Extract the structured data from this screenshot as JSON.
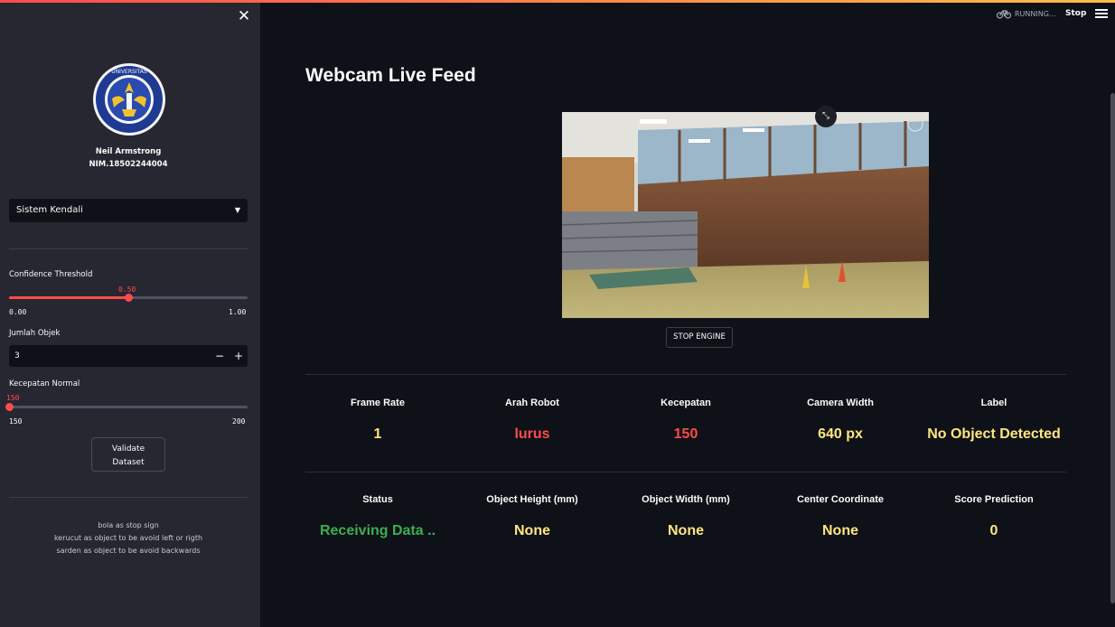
{
  "header": {
    "status_text": "RUNNING...",
    "stop_label": "Stop"
  },
  "sidebar": {
    "profile_name": "Neil Armstrong",
    "profile_nim": "NIM.18502244004",
    "mode_select": {
      "selected": "Sistem Kendali"
    },
    "confidence": {
      "label": "Confidence Threshold",
      "value": "0.50",
      "min": "0.00",
      "max": "1.00",
      "fraction": 0.5
    },
    "jumlah_objek": {
      "label": "Jumlah Objek",
      "value": "3",
      "minus": "−",
      "plus": "+"
    },
    "kecepatan": {
      "label": "Kecepatan Normal",
      "value": "150",
      "min": "150",
      "max": "200",
      "fraction": 0.0
    },
    "validate_button": {
      "line1": "Validate",
      "line2": "Dataset"
    },
    "notes": [
      "bola as stop sign",
      "kerucut as object to be avoid left or rigth",
      "sarden as object to be avoid backwards"
    ]
  },
  "main": {
    "title": "Webcam Live Feed",
    "stop_engine_label": "STOP ENGINE",
    "metrics_row1": [
      {
        "label": "Frame Rate",
        "value": "1",
        "color": "#ffe680"
      },
      {
        "label": "Arah Robot",
        "value": "lurus",
        "color": "#ff4b4b"
      },
      {
        "label": "Kecepatan",
        "value": "150",
        "color": "#ff4b4b"
      },
      {
        "label": "Camera Width",
        "value": "640 px",
        "color": "#ffe680"
      },
      {
        "label": "Label",
        "value": "No Object Detected",
        "color": "#ffe680"
      }
    ],
    "metrics_row2": [
      {
        "label": "Status",
        "value": "Receiving Data ..",
        "color": "#3dae50"
      },
      {
        "label": "Object Height (mm)",
        "value": "None",
        "color": "#ffe680"
      },
      {
        "label": "Object Width (mm)",
        "value": "None",
        "color": "#ffe680"
      },
      {
        "label": "Center Coordinate",
        "value": "None",
        "color": "#ffe680"
      },
      {
        "label": "Score Prediction",
        "value": "0",
        "color": "#ffe680"
      }
    ]
  },
  "colors": {
    "accent": "#ff4b4b",
    "sidebar_bg": "#262730",
    "main_bg": "#0e1117",
    "value_yellow": "#ffe680",
    "status_green": "#3dae50"
  },
  "icons": [
    "close-icon",
    "university-logo",
    "chevron-down-icon",
    "bicycle-icon",
    "hamburger-menu-icon",
    "expand-icon",
    "fullscreen-icon"
  ]
}
